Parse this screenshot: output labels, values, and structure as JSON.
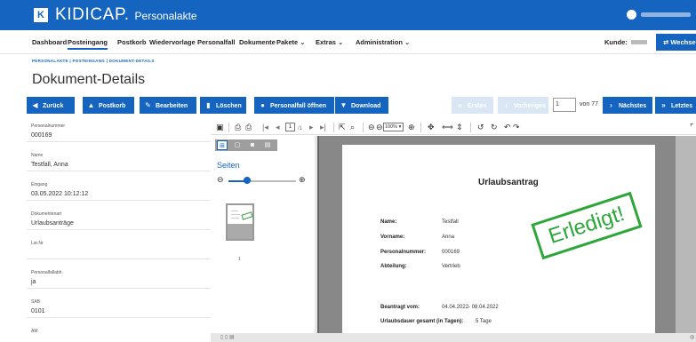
{
  "app": {
    "logo_glyph": "K",
    "brand": "KIDICAP.",
    "brand_sub": "Personalakte",
    "user_icon": "user-circle-icon"
  },
  "nav": {
    "items": [
      "Dashboard",
      "Posteingang",
      "Postkorb",
      "Wiedervorlage",
      "Personalfall",
      "Dokumente",
      "Pakete ⌄",
      "Extras ⌄",
      "Administration ⌄"
    ],
    "active": "Posteingang",
    "kunde_label": "Kunde:",
    "wechseln": "⇄ Wechseln"
  },
  "breadcrumb": "PERSONALAKTE  |  POSTEINGANG  |  DOKUMENT-DETAILS",
  "page_title": "Dokument-Details",
  "toolbar": {
    "zurueck": "Zurück",
    "postkorb": "Postkorb",
    "bearbeiten": "Bearbeiten",
    "loeschen": "Löschen",
    "personalfall": "Personalfall öffnen",
    "download": "Download",
    "erstes": "Erstes",
    "vorheriges": "Vorheriges",
    "page_value": "1",
    "von": "von 77",
    "naechstes": "Nächstes",
    "letztes": "Letztes"
  },
  "fields": [
    {
      "label": "Personalnummer",
      "value": "000169"
    },
    {
      "label": "Name",
      "value": "Testfall, Anna"
    },
    {
      "label": "Eingang",
      "value": "03.05.2022 10:12:12"
    },
    {
      "label": "Dokumentenart",
      "value": "Urlaubsanträge"
    },
    {
      "label": "Lst-Nr",
      "value": ""
    },
    {
      "label": "Personalfallabh.",
      "value": "ja"
    },
    {
      "label": "SAB",
      "value": "0101"
    },
    {
      "label": "AM",
      "value": ""
    }
  ],
  "viewer": {
    "page_field": "1",
    "page_total": "/1",
    "zoom": "100% ▾",
    "sidebar_title": "Seiten",
    "thumb_number": "1"
  },
  "document": {
    "title": "Urlaubsantrag",
    "rows": [
      {
        "label": "Name:",
        "value": "Testfall"
      },
      {
        "label": "Vorname:",
        "value": "Anna"
      },
      {
        "label": "Personalnummer:",
        "value": "000169"
      },
      {
        "label": "Abteilung:",
        "value": "Vertrieb"
      }
    ],
    "beantragt_label": "Beantragt vom:",
    "beantragt_value": "04.04.2022- 08.04.2022",
    "urlaubsdauer_label": "Urlaubsdauer gesamt (in Tagen):",
    "urlaubsdauer_value": "5 Tage",
    "stamp": "Erledigt!"
  },
  "colors": {
    "brand_blue": "#1565c0",
    "stamp_green": "#2ea63a"
  }
}
